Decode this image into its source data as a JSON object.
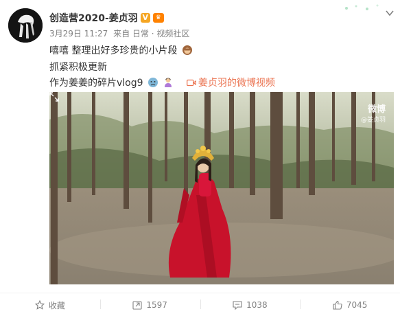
{
  "author": {
    "name": "创造营2020-姜贞羽",
    "verified_badge": "V"
  },
  "meta": {
    "date": "3月29日 11:27",
    "source": "来自 日常 · 视频社区"
  },
  "post": {
    "line1": "嘻嘻 整理出好多珍贵的小片段",
    "line2": "抓紧积极更新",
    "line3": "作为姜姜的碎片vlog9",
    "video_link": "姜贞羽的微博视频"
  },
  "video": {
    "watermark_brand": "微博",
    "watermark_user": "@姜贞羽"
  },
  "actions": {
    "favorite": "收藏",
    "repost": "1597",
    "comment": "1038",
    "like": "7045"
  },
  "icons": {
    "avatar": "avatar-image",
    "expand": "chevron-down-icon",
    "fullscreen": "expand-icon"
  },
  "colors": {
    "link": "#eb7350",
    "meta": "#808080",
    "badge_gold": "#f5a623"
  }
}
